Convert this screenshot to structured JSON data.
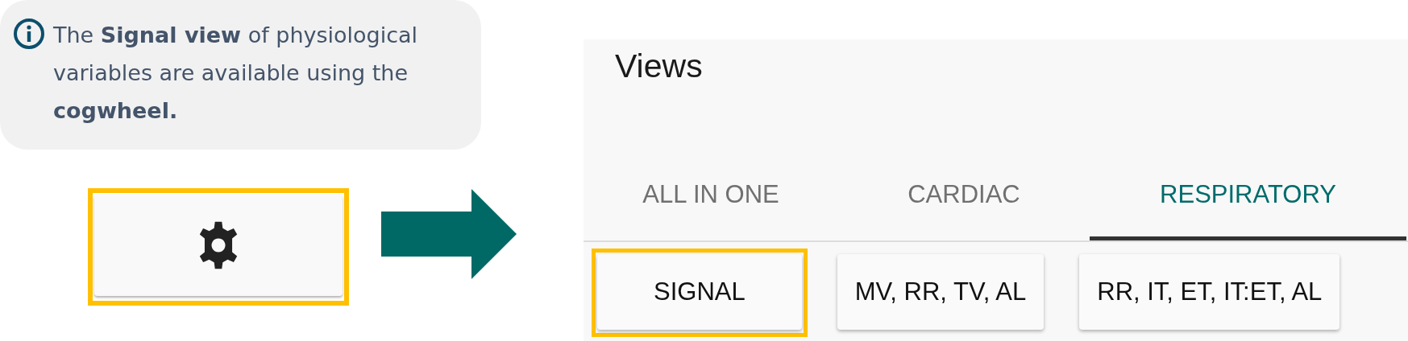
{
  "callout": {
    "text": "The **Signal view** of physiological variables are available using the **cogwheel.**"
  },
  "settings_button": {
    "highlighted": true
  },
  "views_panel": {
    "title": "Views",
    "tabs": [
      {
        "label": "ALL IN ONE",
        "selected": false
      },
      {
        "label": "CARDIAC",
        "selected": false
      },
      {
        "label": "RESPIRATORY",
        "selected": true
      }
    ],
    "view_buttons": [
      {
        "label": "SIGNAL",
        "highlighted": true
      },
      {
        "label": "MV, RR, TV, AL",
        "highlighted": false
      },
      {
        "label": "RR, IT, ET, IT:ET, AL",
        "highlighted": false
      }
    ]
  }
}
